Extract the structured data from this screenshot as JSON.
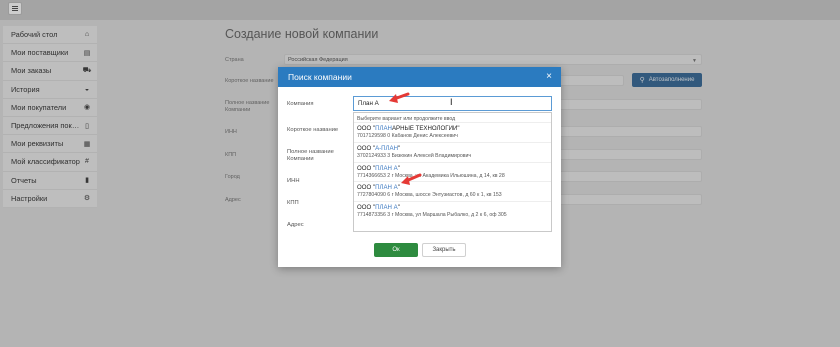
{
  "topbar": {
    "menu_icon": "hamburger-icon"
  },
  "sidebar": {
    "items": [
      {
        "label": "Рабочий стол",
        "icon": "home-icon",
        "glyph": "⌂"
      },
      {
        "label": "Мои поставщики",
        "icon": "building-icon",
        "glyph": "▤"
      },
      {
        "label": "Мои заказы",
        "icon": "cart-icon",
        "glyph": "⛟"
      },
      {
        "label": "История",
        "icon": "basket-icon",
        "glyph": "◒"
      },
      {
        "label": "Мои покупатели",
        "icon": "eye-icon",
        "glyph": "◉"
      },
      {
        "label": "Предложения покуп...",
        "icon": "file-icon",
        "glyph": "▯"
      },
      {
        "label": "Мои реквизиты",
        "icon": "bank-icon",
        "glyph": "▦"
      },
      {
        "label": "Мой классификатор",
        "icon": "hashtag-icon",
        "glyph": "#"
      },
      {
        "label": "Отчеты",
        "icon": "report-icon",
        "glyph": "▮"
      },
      {
        "label": "Настройки",
        "icon": "gears-icon",
        "glyph": "⚙"
      }
    ]
  },
  "form": {
    "title": "Создание новой компании",
    "country_label": "Страна",
    "country_value": "Российская Федерация",
    "short_name_label": "Короткое название",
    "full_name_label": "Полное название Компании",
    "inn_label": "ИНН",
    "kpp_label": "КПП",
    "city_label": "Город",
    "address_label": "Адрес",
    "autofill_button": "Автозаполнение",
    "autofill_icon": "search-icon"
  },
  "modal": {
    "title": "Поиск компании",
    "close_icon": "close-icon",
    "company_label": "Компания",
    "search_value": "План А",
    "short_name_label": "Короткое название",
    "full_name_label": "Полное название Компании",
    "inn_label": "ИНН",
    "kpp_label": "КПП",
    "address_label": "Адрес",
    "dropdown_hint": "Выберите вариант или продолжите ввод",
    "suggestions": [
      {
        "prefix": "ООО \"",
        "match": "ПЛАН",
        "suffix": "АРНЫЕ ТЕХНОЛОГИИ\"",
        "details": "7017129598 0   Кабанов Денис Алексеевич"
      },
      {
        "prefix": "ООО \"",
        "match": "А-ПЛАН",
        "suffix": "\"",
        "details": "3702124933 3   Бизюкин Алексей Владимирович"
      },
      {
        "prefix": "ООО \"",
        "match": "ПЛАН А",
        "suffix": "\"",
        "details": "7714366653 2   г Москва, ул Академика Ильюшина, д 14, кв 28"
      },
      {
        "prefix": "ООО \"",
        "match": "ПЛАН А",
        "suffix": "\"",
        "details": "7727804090 6   г Москва, шоссе Энтузиастов, д 60 к 1, кв 153"
      },
      {
        "prefix": "ООО \"",
        "match": "ПЛАН А",
        "suffix": "\"",
        "details": "7714873356 3   г Москва, ул Маршала Рыбалко, д 2 к 6, оф 305"
      }
    ],
    "ok_button": "Ок",
    "cancel_button": "Закрыть"
  },
  "colors": {
    "header_blue": "#2b7bc0",
    "ok_green": "#2e8b3f",
    "autofill_blue": "#3d6d99",
    "annotation_red": "#e53935"
  }
}
